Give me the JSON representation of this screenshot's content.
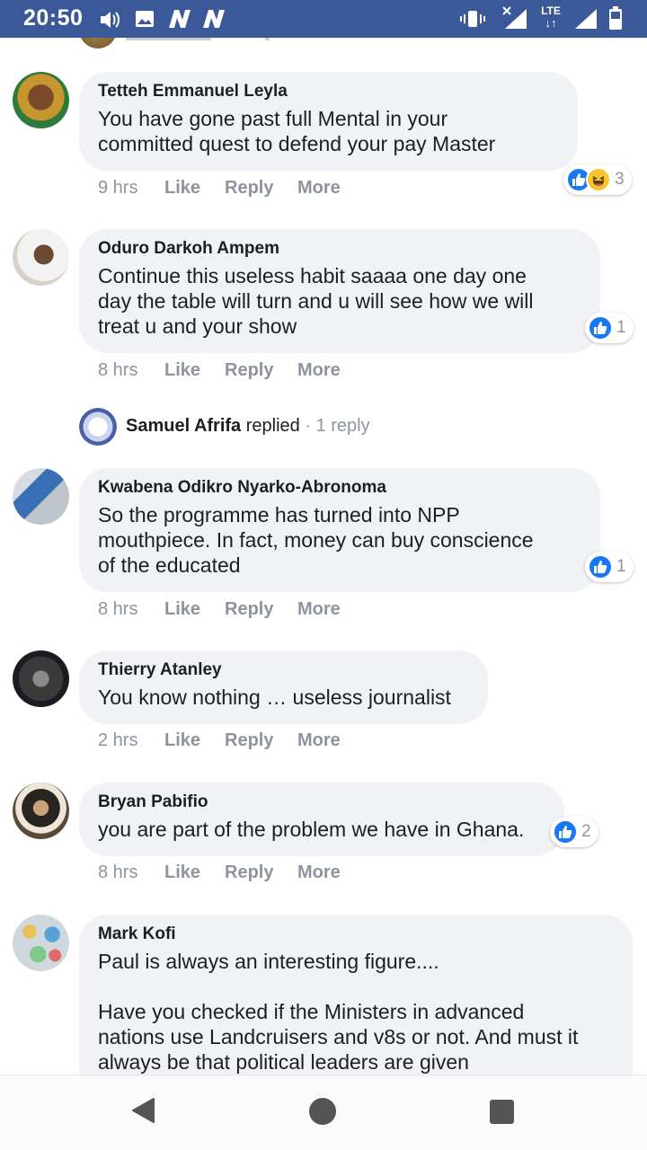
{
  "status_bar": {
    "time": "20:50",
    "network": "LTE",
    "icons": [
      "volume-icon",
      "image-icon",
      "n-app-icon",
      "n-app-icon",
      "vibrate-icon",
      "no-signal-icon",
      "lte-icon",
      "signal-icon",
      "battery-icon"
    ]
  },
  "actions": {
    "like": "Like",
    "reply": "Reply",
    "more": "More"
  },
  "comments": [
    {
      "author": "Tetteh Emmanuel Leyla",
      "text": "You have gone past full Mental in your\ncommitted quest to defend your pay Master",
      "time": "9 hrs",
      "reactions": [
        "like",
        "haha"
      ],
      "reaction_count": "3"
    },
    {
      "author": "Oduro Darkoh Ampem",
      "text": "Continue this useless habit saaaa one day one\nday the table will turn and u will see how we will\ntreat u and your show",
      "time": "8 hrs",
      "reactions": [
        "like"
      ],
      "reaction_count": "1"
    },
    {
      "author": "Kwabena Odikro Nyarko-Abronoma",
      "text": "So the programme has turned into NPP\nmouthpiece. In fact, money can buy conscience\nof the educated",
      "time": "8 hrs",
      "reactions": [
        "like"
      ],
      "reaction_count": "1"
    },
    {
      "author": "Thierry Atanley",
      "text": "You know nothing … useless journalist",
      "time": "2 hrs"
    },
    {
      "author": "Bryan Pabifio",
      "text": "you are part of the problem we have in Ghana.",
      "time": "8 hrs",
      "reactions": [
        "like"
      ],
      "reaction_count": "2"
    },
    {
      "author": "Mark Kofi",
      "text": "Paul is always an interesting figure....\n\nHave you checked if the Ministers in advanced\nnations use Landcruisers and v8s or not. And must it\nalways be that political leaders are given"
    }
  ],
  "reply_summary": {
    "name": "Samuel Afrifa",
    "verb": "replied",
    "separator": "·",
    "count": "1 reply"
  },
  "nav": {
    "icons": [
      "back-triangle-icon",
      "home-circle-icon",
      "recents-square-icon"
    ]
  },
  "colors": {
    "status_bar": "#3b5998",
    "bubble": "#f0f2f5",
    "like_blue": "#1877f2",
    "muted": "#8d949e"
  }
}
